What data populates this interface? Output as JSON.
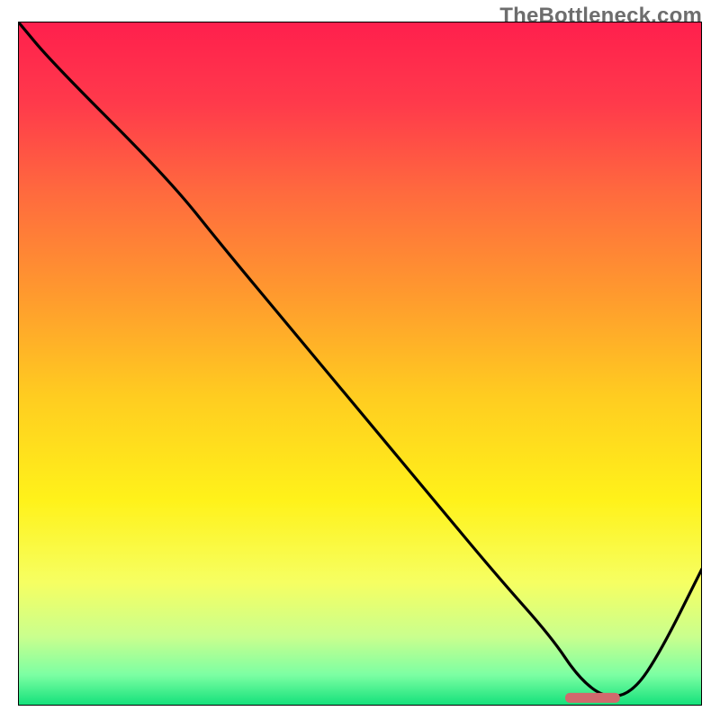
{
  "watermark": {
    "text": "TheBottleneck.com"
  },
  "colors": {
    "line": "#000000",
    "border": "#000000",
    "segment": "#d1696d",
    "gradient_stops": [
      {
        "offset": 0.0,
        "color": "#ff1f4d"
      },
      {
        "offset": 0.12,
        "color": "#ff3a4b"
      },
      {
        "offset": 0.25,
        "color": "#ff6a3e"
      },
      {
        "offset": 0.4,
        "color": "#ff9a2e"
      },
      {
        "offset": 0.55,
        "color": "#ffcd20"
      },
      {
        "offset": 0.7,
        "color": "#fff21a"
      },
      {
        "offset": 0.82,
        "color": "#f6ff62"
      },
      {
        "offset": 0.9,
        "color": "#c9ff8e"
      },
      {
        "offset": 0.955,
        "color": "#7cffa3"
      },
      {
        "offset": 1.0,
        "color": "#12e07a"
      }
    ]
  },
  "chart_data": {
    "type": "line",
    "title": "",
    "xlabel": "",
    "ylabel": "",
    "xlim": [
      0,
      100
    ],
    "ylim": [
      0,
      100
    ],
    "x": [
      0,
      5,
      22,
      30,
      40,
      50,
      60,
      70,
      78,
      82,
      86,
      90,
      94,
      100
    ],
    "values": [
      100,
      94,
      77,
      67,
      55,
      43,
      31,
      19,
      10,
      4,
      1,
      2,
      8,
      20
    ],
    "optimal_segment": {
      "x_start": 80,
      "x_end": 88,
      "y": 1.2
    }
  }
}
